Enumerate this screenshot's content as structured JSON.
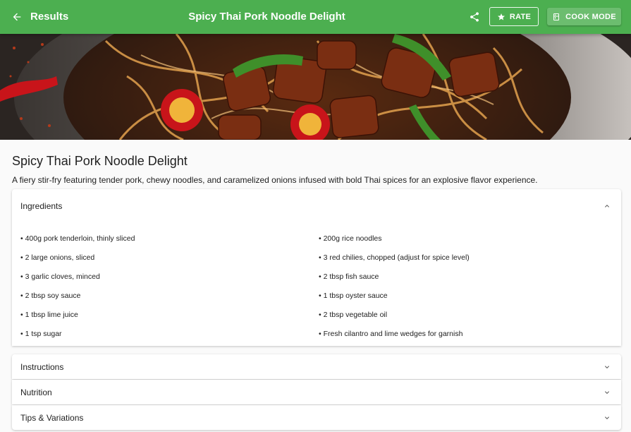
{
  "appbar": {
    "back_label": "Results",
    "title": "Spicy Thai Pork Noodle Delight",
    "rate_label": "RATE",
    "cook_mode_label": "COOK MODE",
    "color": "#4caf50"
  },
  "hero": {
    "icon": "recipe-photo"
  },
  "recipe": {
    "title": "Spicy Thai Pork Noodle Delight",
    "description": "A fiery stir-fry featuring tender pork, chewy noodles, and caramelized onions infused with bold Thai spices for an explosive flavor experience."
  },
  "sections": {
    "ingredients": {
      "label": "Ingredients",
      "expanded": true,
      "items": [
        "• 400g pork tenderloin, thinly sliced",
        "• 200g rice noodles",
        "• 2 large onions, sliced",
        "• 3 red chilies, chopped (adjust for spice level)",
        "• 3 garlic cloves, minced",
        "• 2 tbsp fish sauce",
        "• 2 tbsp soy sauce",
        "• 1 tbsp oyster sauce",
        "• 1 tbsp lime juice",
        "• 2 tbsp vegetable oil",
        "• 1 tsp sugar",
        "• Fresh cilantro and lime wedges for garnish"
      ]
    },
    "instructions": {
      "label": "Instructions",
      "expanded": false
    },
    "nutrition": {
      "label": "Nutrition",
      "expanded": false
    },
    "tips": {
      "label": "Tips & Variations",
      "expanded": false
    }
  }
}
